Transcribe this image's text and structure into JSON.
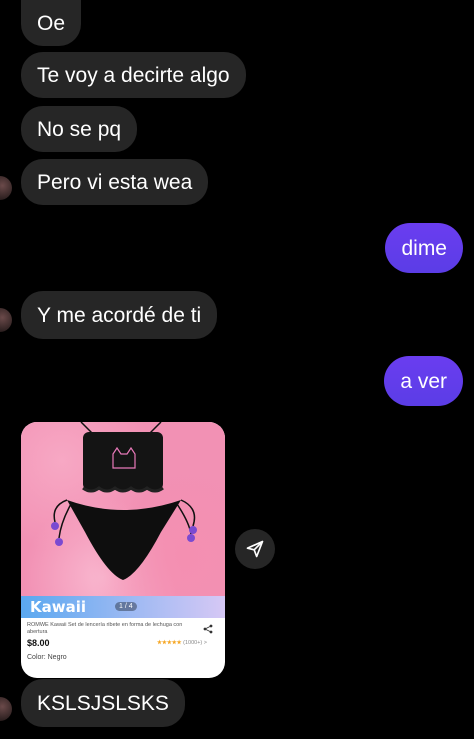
{
  "messages": [
    {
      "text": "Oe",
      "side": "in"
    },
    {
      "text": "Te voy a decirte algo",
      "side": "in"
    },
    {
      "text": "No se pq",
      "side": "in"
    },
    {
      "text": "Pero vi esta wea",
      "side": "in"
    },
    {
      "text": "dime",
      "side": "out"
    },
    {
      "text": "Y me acordé de ti",
      "side": "in"
    },
    {
      "text": "a ver",
      "side": "out"
    },
    {
      "text": "KSLSJSLSKS",
      "side": "in"
    }
  ],
  "product_card": {
    "brand": "Kawaii",
    "pager": "1 / 4",
    "title": "ROMWE Kawaii Set de lencería ribete en forma de lechuga con abertura",
    "price": "$8.00",
    "rating_stars": "★★★★★",
    "rating_count": "(1000+) >",
    "color_label": "Color: Negro"
  },
  "icons": {
    "send": "send-icon",
    "share": "share-icon"
  },
  "colors": {
    "incoming_bubble": "#262626",
    "outgoing_bubble": "#5b3de6",
    "background": "#000000"
  }
}
